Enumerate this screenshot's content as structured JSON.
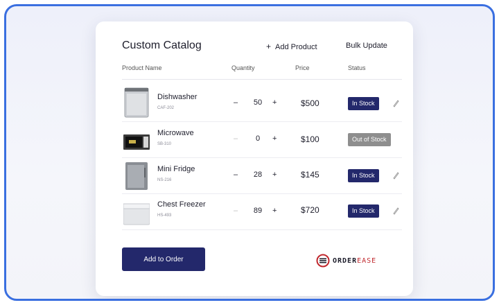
{
  "catalog": {
    "title": "Custom Catalog",
    "add_product_label": "Add Product",
    "add_product_icon": "plus-icon",
    "bulk_update_label": "Bulk Update",
    "columns": {
      "name": "Product Name",
      "quantity": "Quantity",
      "price": "Price",
      "status": "Status"
    },
    "products": [
      {
        "name": "Dishwasher",
        "sku": "CAF-202",
        "quantity": "50",
        "price": "$500",
        "status": "In Stock",
        "in_stock": true,
        "image_icon": "dishwasher-image"
      },
      {
        "name": "Microwave",
        "sku": "SB-310",
        "quantity": "0",
        "price": "$100",
        "status": "Out of Stock",
        "in_stock": false,
        "image_icon": "microwave-image"
      },
      {
        "name": "Mini Fridge",
        "sku": "NS-216",
        "quantity": "28",
        "price": "$145",
        "status": "In Stock",
        "in_stock": true,
        "image_icon": "mini-fridge-image"
      },
      {
        "name": "Chest Freezer",
        "sku": "HS-493",
        "quantity": "89",
        "price": "$720",
        "status": "In Stock",
        "in_stock": true,
        "image_icon": "chest-freezer-image"
      }
    ],
    "minus_symbol": "–",
    "plus_symbol": "+",
    "add_to_order_label": "Add to Order",
    "brand": {
      "part1": "ORDER",
      "part2": "EASE"
    },
    "colors": {
      "accent": "#23286b",
      "out_of_stock": "#8e8e8e",
      "brand_red": "#c0272d",
      "frame_border": "#3a6fe0"
    }
  }
}
